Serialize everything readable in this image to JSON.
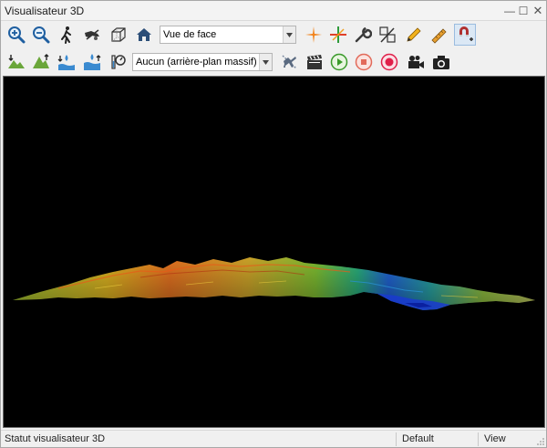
{
  "window": {
    "title": "Visualisateur 3D",
    "controls": {
      "minimize": "—",
      "maximize": "☐",
      "close": "✕"
    }
  },
  "toolbar1": {
    "buttons": [
      {
        "icon": "zoom-in-icon"
      },
      {
        "icon": "zoom-out-icon"
      },
      {
        "icon": "walk-mode-icon"
      },
      {
        "icon": "fly-mode-icon"
      },
      {
        "icon": "wireframe-cube-icon"
      },
      {
        "icon": "home-view-icon"
      }
    ],
    "view_select": {
      "value": "Vue de face"
    },
    "buttons_right": [
      {
        "icon": "crosshair-target-icon"
      },
      {
        "icon": "axes-cross-icon"
      },
      {
        "icon": "wrench-icon"
      },
      {
        "icon": "scale-ratio-icon"
      },
      {
        "icon": "pencil-icon"
      },
      {
        "icon": "ruler-pencil-icon"
      },
      {
        "icon": "magnet-plus-icon",
        "active": true
      }
    ]
  },
  "toolbar2": {
    "buttons": [
      {
        "icon": "terrain-low-icon"
      },
      {
        "icon": "terrain-high-icon"
      },
      {
        "icon": "water-level-down-icon"
      },
      {
        "icon": "water-level-up-icon"
      },
      {
        "icon": "weather-gauge-icon"
      }
    ],
    "background_select": {
      "value": "Aucun (arrière-plan massif)"
    },
    "buttons_right": [
      {
        "icon": "flight-path-icon"
      },
      {
        "icon": "clapperboard-icon"
      },
      {
        "icon": "play-icon"
      },
      {
        "icon": "stop-icon"
      },
      {
        "icon": "record-icon"
      },
      {
        "icon": "video-camera-icon"
      },
      {
        "icon": "photo-camera-icon"
      }
    ]
  },
  "colors": {
    "viewport_background": "#000000",
    "play_green": "#3a9a2a",
    "stop_red": "#e26a5a",
    "record_red": "#e0204a"
  },
  "statusbar": {
    "status_text": "Statut visualisateur 3D",
    "mode": "Default",
    "section": "View"
  }
}
